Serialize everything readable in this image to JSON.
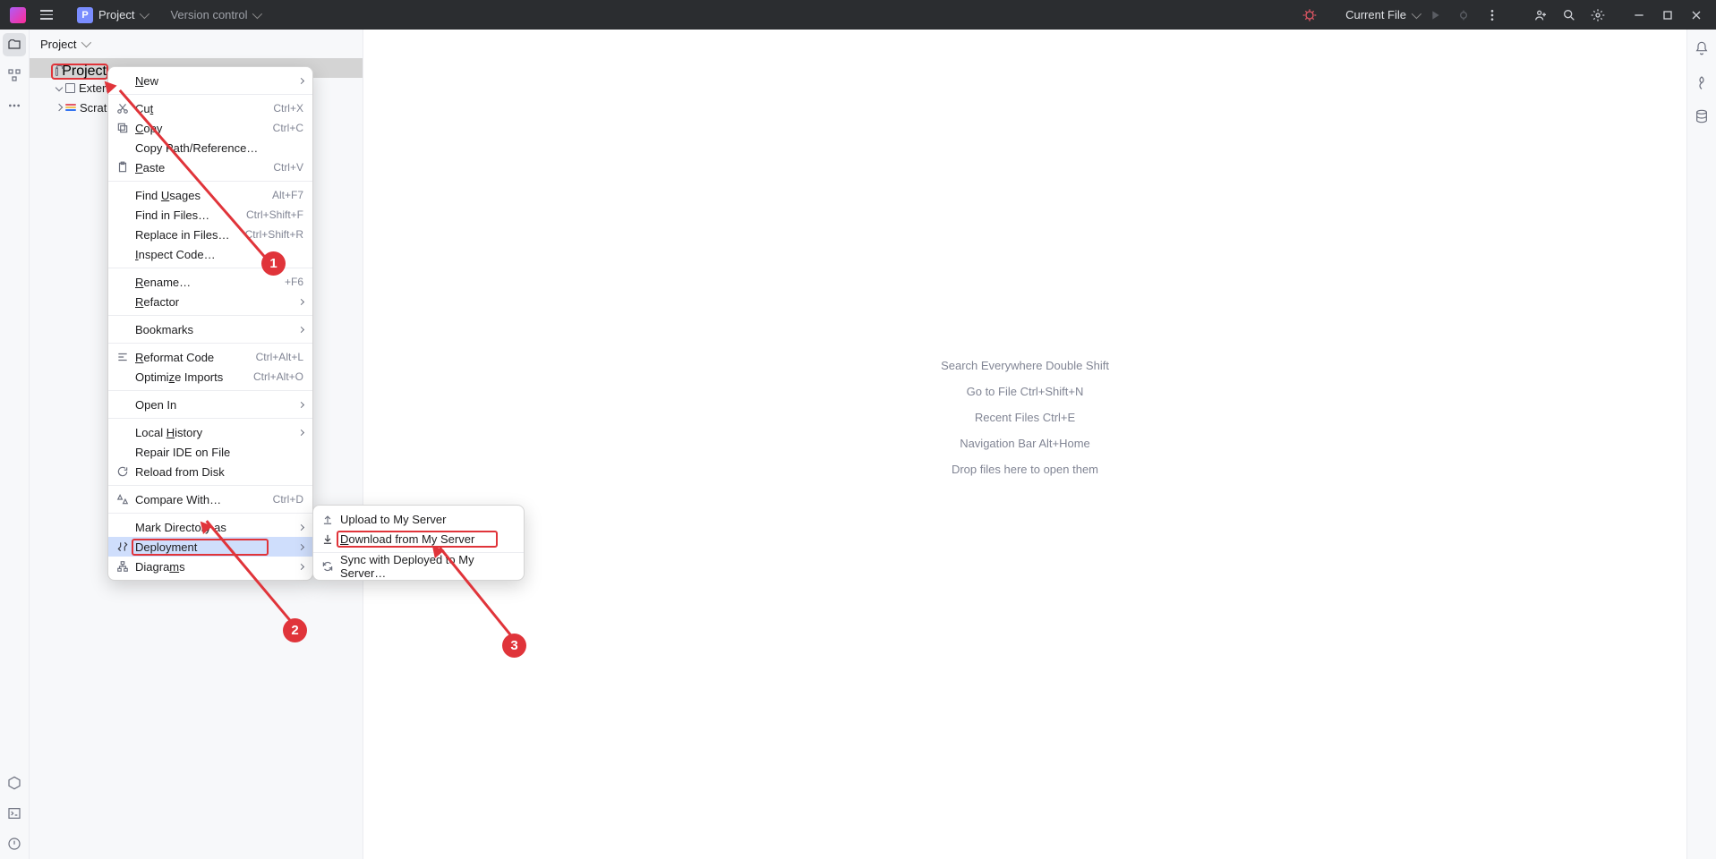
{
  "topbar": {
    "project_label": "Project",
    "project_letter": "P",
    "vc_label": "Version control",
    "current_file": "Current File"
  },
  "sidebar": {
    "header": "Project",
    "tree": {
      "root": "Project",
      "external": "Extern",
      "scratches": "Scratche"
    }
  },
  "editor_hints": {
    "h1": "Search Everywhere Double Shift",
    "h2": "Go to File Ctrl+Shift+N",
    "h3": "Recent Files Ctrl+E",
    "h4": "Navigation Bar Alt+Home",
    "h5": "Drop files here to open them"
  },
  "menu": {
    "new": "New",
    "cut": "Cut",
    "cut_sc": "Ctrl+X",
    "copy": "Copy",
    "copy_sc": "Ctrl+C",
    "copy_path": "Copy Path/Reference…",
    "paste": "Paste",
    "paste_sc": "Ctrl+V",
    "find_usages": "Find Usages",
    "find_usages_sc": "Alt+F7",
    "find_in_files": "Find in Files…",
    "find_in_files_sc": "Ctrl+Shift+F",
    "replace_in_files": "Replace in Files…",
    "replace_in_files_sc": "Ctrl+Shift+R",
    "inspect_code": "Inspect Code…",
    "rename": "Rename…",
    "rename_sc": "+F6",
    "refactor": "Refactor",
    "bookmarks": "Bookmarks",
    "reformat": "Reformat Code",
    "reformat_sc": "Ctrl+Alt+L",
    "optimize": "Optimize Imports",
    "optimize_sc": "Ctrl+Alt+O",
    "open_in": "Open In",
    "local_history": "Local History",
    "repair": "Repair IDE on File",
    "reload": "Reload from Disk",
    "compare": "Compare With…",
    "compare_sc": "Ctrl+D",
    "mark_dir": "Mark Directory as",
    "deployment": "Deployment",
    "diagrams": "Diagrams"
  },
  "submenu": {
    "upload": "Upload to My Server",
    "download": "Download from My Server",
    "sync": "Sync with Deployed to My Server…"
  },
  "annotations": {
    "b1": "1",
    "b2": "2",
    "b3": "3"
  }
}
